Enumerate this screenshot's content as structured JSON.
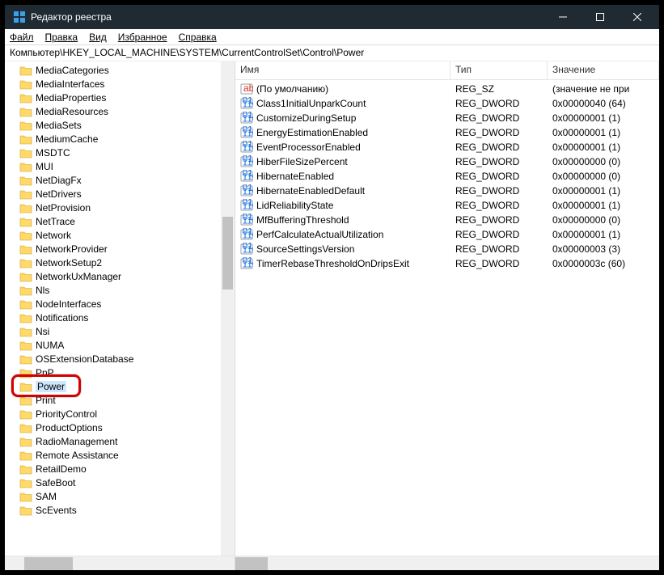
{
  "window": {
    "title": "Редактор реестра"
  },
  "menubar": {
    "items": [
      "Файл",
      "Правка",
      "Вид",
      "Избранное",
      "Справка"
    ]
  },
  "addressbar": {
    "path": "Компьютер\\HKEY_LOCAL_MACHINE\\SYSTEM\\CurrentControlSet\\Control\\Power"
  },
  "tree": {
    "items": [
      "MediaCategories",
      "MediaInterfaces",
      "MediaProperties",
      "MediaResources",
      "MediaSets",
      "MediumCache",
      "MSDTC",
      "MUI",
      "NetDiagFx",
      "NetDrivers",
      "NetProvision",
      "NetTrace",
      "Network",
      "NetworkProvider",
      "NetworkSetup2",
      "NetworkUxManager",
      "Nls",
      "NodeInterfaces",
      "Notifications",
      "Nsi",
      "NUMA",
      "OSExtensionDatabase",
      "PnP",
      "Power",
      "Print",
      "PriorityControl",
      "ProductOptions",
      "RadioManagement",
      "Remote Assistance",
      "RetailDemo",
      "SafeBoot",
      "SAM",
      "ScEvents"
    ],
    "selected_index": 23
  },
  "list": {
    "columns": {
      "name": "Имя",
      "type": "Тип",
      "value": "Значение"
    },
    "rows": [
      {
        "icon": "string",
        "name": "(По умолчанию)",
        "type": "REG_SZ",
        "value": "(значение не при"
      },
      {
        "icon": "dword",
        "name": "Class1InitialUnparkCount",
        "type": "REG_DWORD",
        "value": "0x00000040 (64)"
      },
      {
        "icon": "dword",
        "name": "CustomizeDuringSetup",
        "type": "REG_DWORD",
        "value": "0x00000001 (1)"
      },
      {
        "icon": "dword",
        "name": "EnergyEstimationEnabled",
        "type": "REG_DWORD",
        "value": "0x00000001 (1)"
      },
      {
        "icon": "dword",
        "name": "EventProcessorEnabled",
        "type": "REG_DWORD",
        "value": "0x00000001 (1)"
      },
      {
        "icon": "dword",
        "name": "HiberFileSizePercent",
        "type": "REG_DWORD",
        "value": "0x00000000 (0)"
      },
      {
        "icon": "dword",
        "name": "HibernateEnabled",
        "type": "REG_DWORD",
        "value": "0x00000000 (0)"
      },
      {
        "icon": "dword",
        "name": "HibernateEnabledDefault",
        "type": "REG_DWORD",
        "value": "0x00000001 (1)"
      },
      {
        "icon": "dword",
        "name": "LidReliabilityState",
        "type": "REG_DWORD",
        "value": "0x00000001 (1)"
      },
      {
        "icon": "dword",
        "name": "MfBufferingThreshold",
        "type": "REG_DWORD",
        "value": "0x00000000 (0)"
      },
      {
        "icon": "dword",
        "name": "PerfCalculateActualUtilization",
        "type": "REG_DWORD",
        "value": "0x00000001 (1)"
      },
      {
        "icon": "dword",
        "name": "SourceSettingsVersion",
        "type": "REG_DWORD",
        "value": "0x00000003 (3)"
      },
      {
        "icon": "dword",
        "name": "TimerRebaseThresholdOnDripsExit",
        "type": "REG_DWORD",
        "value": "0x0000003c (60)"
      }
    ]
  }
}
